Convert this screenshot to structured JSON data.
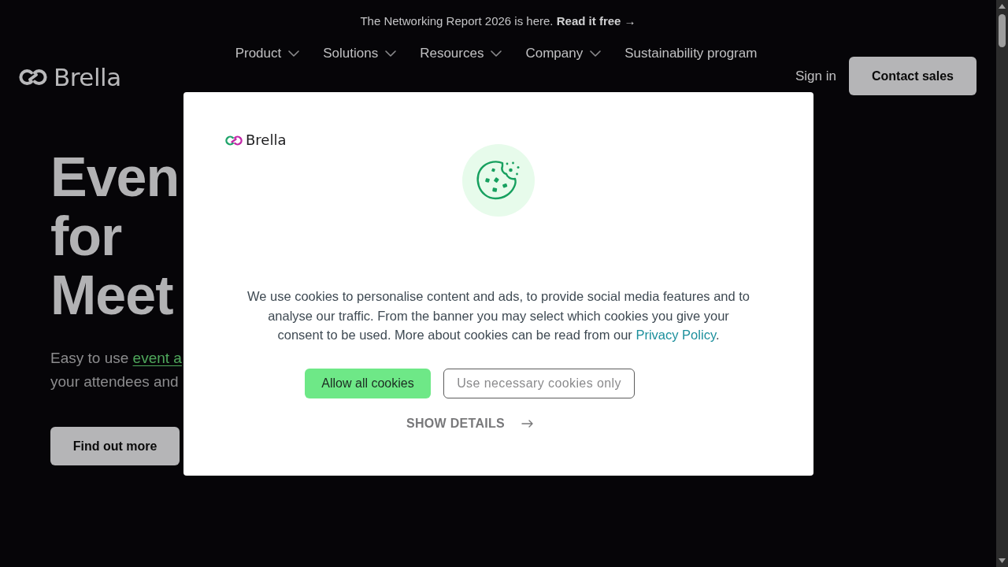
{
  "announcement": {
    "text": "The Networking Report 2026 is here.",
    "link": "Read it free →"
  },
  "header": {
    "logo": {
      "name": "Brella"
    },
    "nav": [
      {
        "label": "Product",
        "kind": "dropdown"
      },
      {
        "label": "Solutions",
        "kind": "dropdown"
      },
      {
        "label": "Resources",
        "kind": "dropdown"
      },
      {
        "label": "Company",
        "kind": "dropdown"
      },
      {
        "label": "Sustainability program",
        "kind": "link"
      }
    ],
    "sign_in": "Sign in",
    "cta": "Contact sales"
  },
  "hero": {
    "heading_lines": [
      "Even",
      "for",
      "Meet"
    ],
    "subtitle": {
      "text_before_link": "Easy to use",
      "link": "event a",
      "text_after_link": "your attendees and"
    },
    "button": "Find out more"
  },
  "cookie_dialog": {
    "logo": {
      "name": "Brella"
    },
    "message": {
      "text_before_link": "We use cookies to personalise content and ads, to provide social media features and to analyse our traffic. From the banner you may select which cookies you give your consent to be used. More about cookies can be read from our",
      "link": "Privacy Policy",
      "text_after_link": "."
    },
    "buttons": [
      {
        "label": "Allow all cookies",
        "kind": "primary"
      },
      {
        "label": "Use necessary cookies only",
        "kind": "secondary"
      }
    ],
    "details_link": "SHOW DETAILS"
  }
}
